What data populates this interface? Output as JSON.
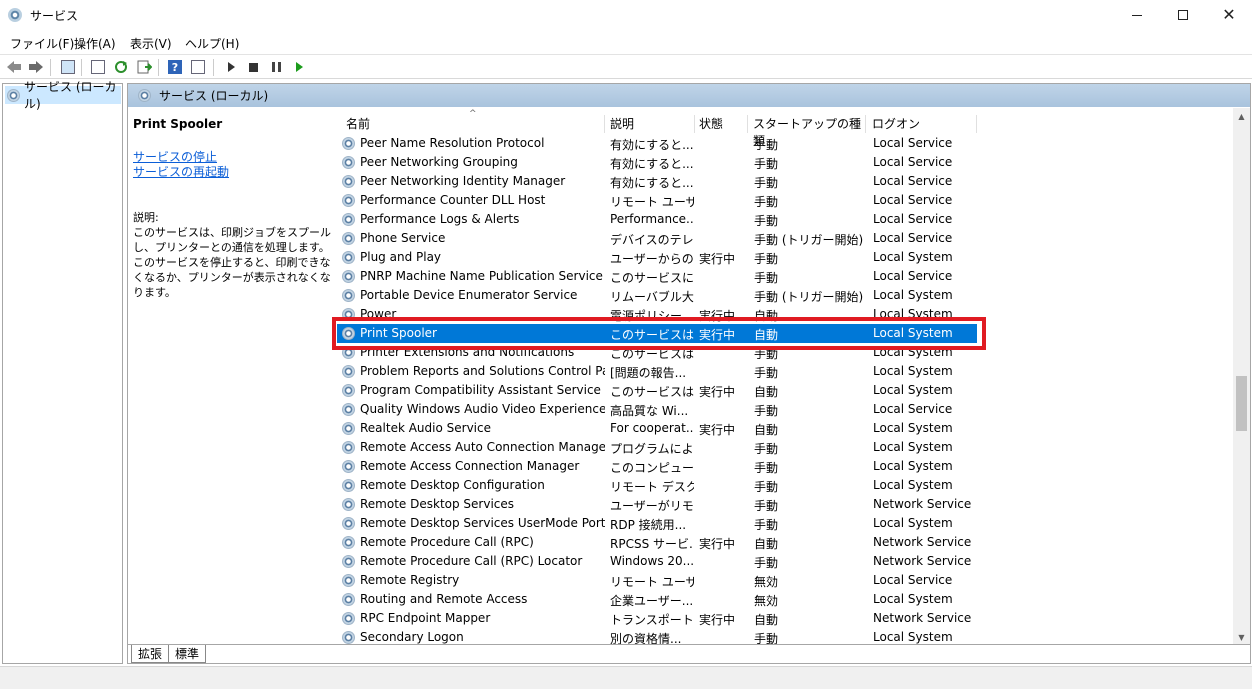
{
  "window": {
    "title": "サービス"
  },
  "menu": {
    "items": [
      "ファイル(F)",
      "操作(A)",
      "表示(V)",
      "ヘルプ(H)"
    ]
  },
  "tree": {
    "item": "サービス (ローカル)"
  },
  "content": {
    "header": "サービス (ローカル)",
    "selected_name": "Print Spooler",
    "links": [
      "サービスの停止",
      "サービスの再起動"
    ],
    "description_label": "説明:",
    "description": "このサービスは、印刷ジョブをスプールし、プリンターとの通信を処理します。このサービスを停止すると、印刷できなくなるか、プリンターが表示されなくなります。"
  },
  "columns": [
    "名前",
    "説明",
    "状態",
    "スタートアップの種類",
    "ログオン"
  ],
  "rows": [
    {
      "name": "Peer Name Resolution Protocol",
      "desc": "有効にすると...",
      "status": "",
      "startup": "手動",
      "logon": "Local Service"
    },
    {
      "name": "Peer Networking Grouping",
      "desc": "有効にすると...",
      "status": "",
      "startup": "手動",
      "logon": "Local Service"
    },
    {
      "name": "Peer Networking Identity Manager",
      "desc": "有効にすると...",
      "status": "",
      "startup": "手動",
      "logon": "Local Service"
    },
    {
      "name": "Performance Counter DLL Host",
      "desc": "リモート ユーザ...",
      "status": "",
      "startup": "手動",
      "logon": "Local Service"
    },
    {
      "name": "Performance Logs & Alerts",
      "desc": "Performance...",
      "status": "",
      "startup": "手動",
      "logon": "Local Service"
    },
    {
      "name": "Phone Service",
      "desc": "デバイスのテレ...",
      "status": "",
      "startup": "手動 (トリガー開始)",
      "logon": "Local Service"
    },
    {
      "name": "Plug and Play",
      "desc": "ユーザーからの...",
      "status": "実行中",
      "startup": "手動",
      "logon": "Local System"
    },
    {
      "name": "PNRP Machine Name Publication Service",
      "desc": "このサービスに...",
      "status": "",
      "startup": "手動",
      "logon": "Local Service"
    },
    {
      "name": "Portable Device Enumerator Service",
      "desc": "リムーバブル大...",
      "status": "",
      "startup": "手動 (トリガー開始)",
      "logon": "Local System"
    },
    {
      "name": "Power",
      "desc": "電源ポリシー...",
      "status": "実行中",
      "startup": "自動",
      "logon": "Local System"
    },
    {
      "name": "Print Spooler",
      "desc": "このサービスは...",
      "status": "実行中",
      "startup": "自動",
      "logon": "Local System",
      "selected": true
    },
    {
      "name": "Printer Extensions and Notifications",
      "desc": "このサービスは...",
      "status": "",
      "startup": "手動",
      "logon": "Local System"
    },
    {
      "name": "Problem Reports and Solutions Control Pan...",
      "desc": "[問題の報告...",
      "status": "",
      "startup": "手動",
      "logon": "Local System"
    },
    {
      "name": "Program Compatibility Assistant Service",
      "desc": "このサービスは...",
      "status": "実行中",
      "startup": "自動",
      "logon": "Local System"
    },
    {
      "name": "Quality Windows Audio Video Experience",
      "desc": "高品質な Wi...",
      "status": "",
      "startup": "手動",
      "logon": "Local Service"
    },
    {
      "name": "Realtek Audio Service",
      "desc": "For cooperat...",
      "status": "実行中",
      "startup": "自動",
      "logon": "Local System"
    },
    {
      "name": "Remote Access Auto Connection Manager",
      "desc": "プログラムによ...",
      "status": "",
      "startup": "手動",
      "logon": "Local System"
    },
    {
      "name": "Remote Access Connection Manager",
      "desc": "このコンピュータ...",
      "status": "",
      "startup": "手動",
      "logon": "Local System"
    },
    {
      "name": "Remote Desktop Configuration",
      "desc": "リモート デスク...",
      "status": "",
      "startup": "手動",
      "logon": "Local System"
    },
    {
      "name": "Remote Desktop Services",
      "desc": "ユーザーがリモ...",
      "status": "",
      "startup": "手動",
      "logon": "Network Service"
    },
    {
      "name": "Remote Desktop Services UserMode Port Re...",
      "desc": "RDP 接続用...",
      "status": "",
      "startup": "手動",
      "logon": "Local System"
    },
    {
      "name": "Remote Procedure Call (RPC)",
      "desc": "RPCSS サービ...",
      "status": "実行中",
      "startup": "自動",
      "logon": "Network Service"
    },
    {
      "name": "Remote Procedure Call (RPC) Locator",
      "desc": "Windows 20...",
      "status": "",
      "startup": "手動",
      "logon": "Network Service"
    },
    {
      "name": "Remote Registry",
      "desc": "リモート ユーザ...",
      "status": "",
      "startup": "無効",
      "logon": "Local Service"
    },
    {
      "name": "Routing and Remote Access",
      "desc": "企業ユーザー...",
      "status": "",
      "startup": "無効",
      "logon": "Local System"
    },
    {
      "name": "RPC Endpoint Mapper",
      "desc": "トランスポート...",
      "status": "実行中",
      "startup": "自動",
      "logon": "Network Service"
    },
    {
      "name": "Secondary Logon",
      "desc": "別の資格情...",
      "status": "",
      "startup": "手動",
      "logon": "Local System"
    }
  ],
  "tabs": [
    "拡張",
    "標準"
  ],
  "colors": {
    "selection": "#0078d7",
    "highlight_border": "#e01b22",
    "header_band": "#b5cce3"
  }
}
